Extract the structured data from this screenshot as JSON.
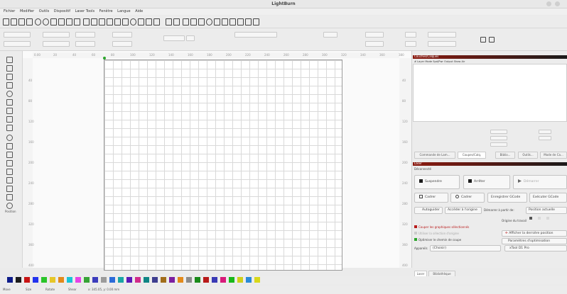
{
  "window": {
    "title": "LightBurn"
  },
  "menu": [
    "Fichier",
    "Modifier",
    "Outils",
    "Dispositif",
    "Laser Tools",
    "Fenêtre",
    "Langue",
    "Aide"
  ],
  "leftbar": {
    "label": "Position"
  },
  "rulers": {
    "top": [
      "0.00",
      "20",
      "40",
      "60",
      "80",
      "100",
      "120",
      "140",
      "160",
      "180",
      "200",
      "220",
      "240",
      "260",
      "280",
      "300",
      "320",
      "340",
      "360",
      "380"
    ],
    "left": [
      "40",
      "80",
      "120",
      "160",
      "200",
      "240",
      "280",
      "320",
      "360",
      "400"
    ],
    "right": [
      "40",
      "80",
      "120",
      "160",
      "200",
      "240",
      "280",
      "320",
      "360",
      "400"
    ]
  },
  "cuts_panel": {
    "header": "Couches/Calques",
    "columns": "#   Layer  Mode  Spd/Pwr  Output  Show  Air"
  },
  "mid_tabs": [
    "Commande de Lam...",
    "Coupes/Calq.",
    "Biblio...",
    "Outils...",
    "Mode de Ca..."
  ],
  "laser_panel": {
    "header": "Laser",
    "status": "Déconnecté",
    "buttons": {
      "pause": "Suspendre",
      "stop": "Arrêter",
      "start": "Démarrer",
      "frame1": "Cadrer",
      "frame2": "Cadrer",
      "save_gcode": "Enregistrer GCode",
      "run_gcode": "Exécuter GCode"
    },
    "pos_row": [
      "Autoguider",
      "Accéder à l'origine",
      "Démarrer à partir de:",
      "Position actuelle"
    ],
    "origin": "Origine du travail",
    "checks": [
      "Couper les graphiques sélectionnés",
      "Utiliser la sélection d'origine",
      "Optimiser le chemin de coupe"
    ],
    "links": [
      "Afficher la dernière position",
      "Paramètres d'optimisation"
    ],
    "device_label": "Appareils",
    "device_value": "(Choisir)",
    "device_select": "xTool D1 Pro"
  },
  "bottom_tabs": [
    "Laser",
    "Bibliothèque"
  ],
  "statusbar": [
    "Move",
    "Size",
    "Rotate",
    "Shear",
    "x: 345.05, y: 0.00 mm"
  ],
  "colors": {
    "swatches": [
      "#0e1c8a",
      "#1d1d1d",
      "#c81414",
      "#2233ee",
      "#29c429",
      "#e6c728",
      "#e38a1a",
      "#17c4d6",
      "#e642e6",
      "#37a437",
      "#3c3cbc",
      "#9b9b9b",
      "#2b6bd8",
      "#19a5a5",
      "#5a1ab8",
      "#d12b8b",
      "#0e8585",
      "#3d3d8f",
      "#a16d1a",
      "#7c1fa0",
      "#e38a1a",
      "#8b8b8b",
      "#1a8a1a",
      "#b81a1a",
      "#3a3ab5",
      "#d81a7a",
      "#1ab81a",
      "#cfcf1a",
      "#2a8ad8",
      "#d8d81a"
    ],
    "panel_header_start": "#8b1a10",
    "panel_header_end": "#1a1a1a"
  }
}
